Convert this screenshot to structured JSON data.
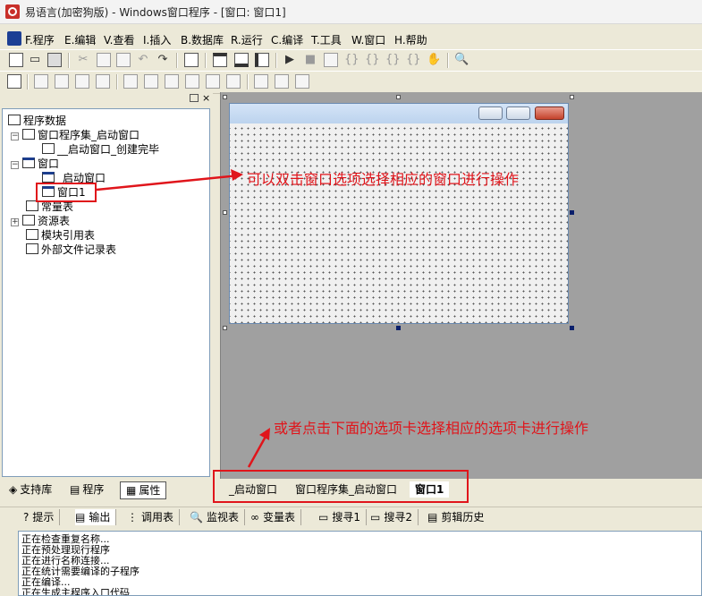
{
  "titlebar": {
    "title": "易语言(加密狗版) - Windows窗口程序 - [窗口: 窗口1]"
  },
  "menu": {
    "items": [
      "F.程序",
      "E.编辑",
      "V.查看",
      "I.插入",
      "B.数据库",
      "R.运行",
      "C.编译",
      "T.工具",
      "W.窗口",
      "H.帮助"
    ]
  },
  "tree": {
    "root": "程序数据",
    "nodes": [
      "窗口程序集_启动窗口",
      "__启动窗口_创建完毕",
      "窗口",
      "_启动窗口",
      "窗口1",
      "常量表",
      "资源表",
      "模块引用表",
      "外部文件记录表"
    ]
  },
  "left_tabs": [
    "支持库",
    "程序",
    "属性"
  ],
  "file_tabs": [
    "_启动窗口",
    "窗口程序集_启动窗口",
    "窗口1"
  ],
  "output_tabs": [
    "提示",
    "输出",
    "调用表",
    "监视表",
    "变量表",
    "搜寻1",
    "搜寻2",
    "剪辑历史"
  ],
  "output_lines": [
    "正在检查重复名称...",
    "正在预处理现行程序",
    "正在进行名称连接...",
    "正在统计需要编译的子程序",
    "正在编译...",
    "正在生成主程序入口代码"
  ],
  "annotations": {
    "top": "可以双击窗口选项选择相应的窗口进行操作",
    "bottom": "或者点击下面的选项卡选择相应的选项卡进行操作"
  },
  "colors": {
    "annotation": "#e0151b",
    "design_bg": "#a0a0a0",
    "form_caption": "#c7daf1"
  },
  "icons": [
    "app-icon",
    "new-file-icon",
    "open-icon",
    "save-icon",
    "cut-icon",
    "copy-icon",
    "paste-icon",
    "undo-icon",
    "redo-icon",
    "run-icon",
    "stop-icon",
    "minimize-icon",
    "maximize-icon",
    "close-icon",
    "search-icon"
  ]
}
